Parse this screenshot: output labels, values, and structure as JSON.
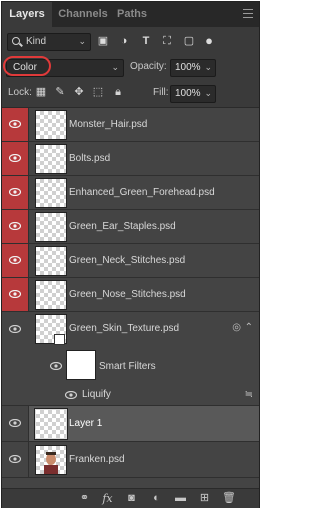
{
  "tabs": [
    {
      "label": "Layers",
      "active": true
    },
    {
      "label": "Channels",
      "active": false
    },
    {
      "label": "Paths",
      "active": false
    }
  ],
  "filter": {
    "kind_label": "Kind",
    "icons": [
      "image-filter-icon",
      "adjustment-filter-icon",
      "type-filter-icon",
      "shape-filter-icon",
      "smart-object-filter-icon",
      "filter-toggle-icon"
    ]
  },
  "blend": {
    "mode": "Color",
    "opacity_label": "Opacity:",
    "opacity_value": "100%",
    "lock_label": "Lock:",
    "fill_label": "Fill:",
    "fill_value": "100%"
  },
  "layers": [
    {
      "name": "Monster_Hair.psd",
      "red": true
    },
    {
      "name": "Bolts.psd",
      "red": true
    },
    {
      "name": "Enhanced_Green_Forehead.psd",
      "red": true
    },
    {
      "name": "Green_Ear_Staples.psd",
      "red": true
    },
    {
      "name": "Green_Neck_Stitches.psd",
      "red": true
    },
    {
      "name": "Green_Nose_Stitches.psd",
      "red": true
    },
    {
      "name": "Green_Skin_Texture.psd",
      "red": false
    },
    {
      "name": "Smart Filters",
      "red": false
    },
    {
      "name": "Liquify",
      "red": false
    },
    {
      "name": "Layer 1",
      "red": false,
      "selected": true
    },
    {
      "name": "Franken.psd",
      "red": false
    }
  ],
  "colors": {
    "accent_red": "#b7393b",
    "highlight_ring": "#e03a3a",
    "panel_bg": "#3a3a3a"
  }
}
